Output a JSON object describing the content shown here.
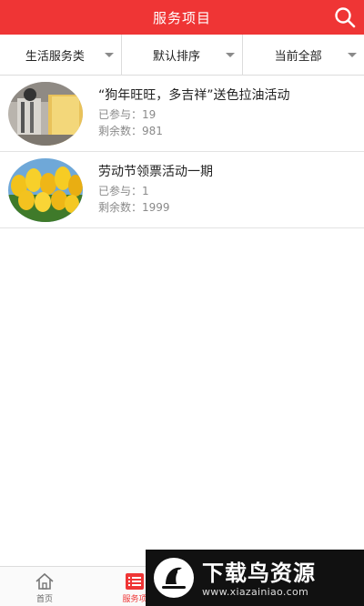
{
  "header": {
    "title": "服务项目",
    "search_icon": "search-icon"
  },
  "filters": [
    {
      "label": "生活服务类"
    },
    {
      "label": "默认排序"
    },
    {
      "label": "当前全部"
    }
  ],
  "items": [
    {
      "title": "“狗年旺旺，多吉祥”送色拉油活动",
      "joined": "已参与：19",
      "remaining": "剩余数：981"
    },
    {
      "title": "劳动节领票活动一期",
      "joined": "已参与：1",
      "remaining": "剩余数：1999"
    }
  ],
  "tabbar": {
    "home": {
      "label": "首页",
      "icon": "home-icon"
    },
    "services": {
      "label": "服务项",
      "icon": "list-icon",
      "active": true
    }
  },
  "watermark": {
    "title": "下载鸟资源",
    "url": "www.xiazainiao.com"
  },
  "colors": {
    "accent": "#ef3535",
    "divider": "#dcdcdc",
    "muted": "#8a8a8a"
  }
}
